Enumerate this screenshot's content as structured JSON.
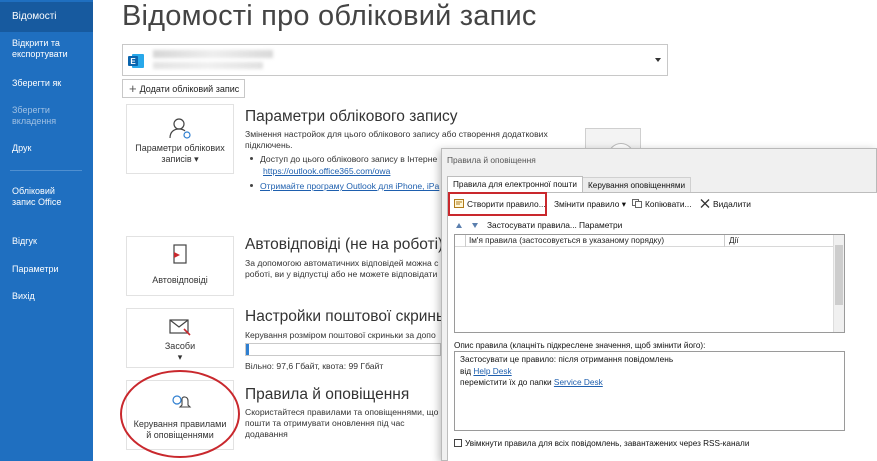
{
  "sidebar": {
    "items": [
      {
        "label": "Відомості"
      },
      {
        "label": "Відкрити та експортувати"
      },
      {
        "label": "Зберегти як"
      },
      {
        "label": "Зберегти вкладення"
      },
      {
        "label": "Друк"
      },
      {
        "label": "Обліковий запис Office"
      },
      {
        "label": "Відгук"
      },
      {
        "label": "Параметри"
      },
      {
        "label": "Вихід"
      }
    ]
  },
  "main": {
    "page_title": "Відомості про обліковий запис",
    "add_account_label": "Додати обліковий запис",
    "sections": {
      "account_settings": {
        "tile_label": "Параметри облікових записів",
        "title": "Параметри облікового запису",
        "desc": "Змінення настройок для цього облікового запису або створення додаткових підключень.",
        "bullet": "Доступ до цього облікового запису в Інтерне",
        "link1": "https://outlook.office365.com/owa",
        "link2": "Отримайте програму Outlook для iPhone, iPa"
      },
      "auto_reply": {
        "tile_label": "Автовідповіді",
        "title": "Автовідповіді (не на роботі)",
        "desc": "За допомогою автоматичних відповідей можна с роботі, ви у відпустці або не можете відповідати"
      },
      "mailbox": {
        "tile_label": "Засоби",
        "title": "Настройки поштової скриньки",
        "desc": "Керування розміром поштової скриньки за допо",
        "quota_text": "Вільно: 97,6 Гбайт, квота: 99 Гбайт",
        "quota_used_fraction": 0.014
      },
      "rules": {
        "tile_label": "Керування правилами й оповіщеннями",
        "title": "Правила й оповіщення",
        "desc": "Скористайтеся правилами та оповіщеннями, що пошти та отримувати оновлення під час додавання"
      }
    }
  },
  "dialog": {
    "title": "Правила й оповіщення",
    "tabs": [
      {
        "label": "Правила для електронної пошти"
      },
      {
        "label": "Керування оповіщеннями"
      }
    ],
    "toolbar": {
      "create": "Створити правило...",
      "change": "Змінити правило",
      "copy": "Копіювати...",
      "delete": "Видалити",
      "apply": "Застосувати правила...",
      "options": "Параметри"
    },
    "list": {
      "col_name": "Ім'я правила (застосовується в указаному порядку)",
      "col_actions": "Дії"
    },
    "desc_label": "Опис правила (клацніть підкреслене значення, щоб змінити його):",
    "desc": {
      "line1": "Застосувати це правило: після отримання повідомлень",
      "line2_prefix": "від ",
      "line2_link": "Help Desk",
      "line3_prefix": "перемістити їх до папки ",
      "line3_link": "Service Desk"
    },
    "rss_checkbox": "Увімкнути правила для всіх повідомлень, завантажених через RSS-канали"
  },
  "colors": {
    "sidebar": "#1f6fc0",
    "highlight_red": "#c9282d",
    "link": "#1e5fae"
  }
}
